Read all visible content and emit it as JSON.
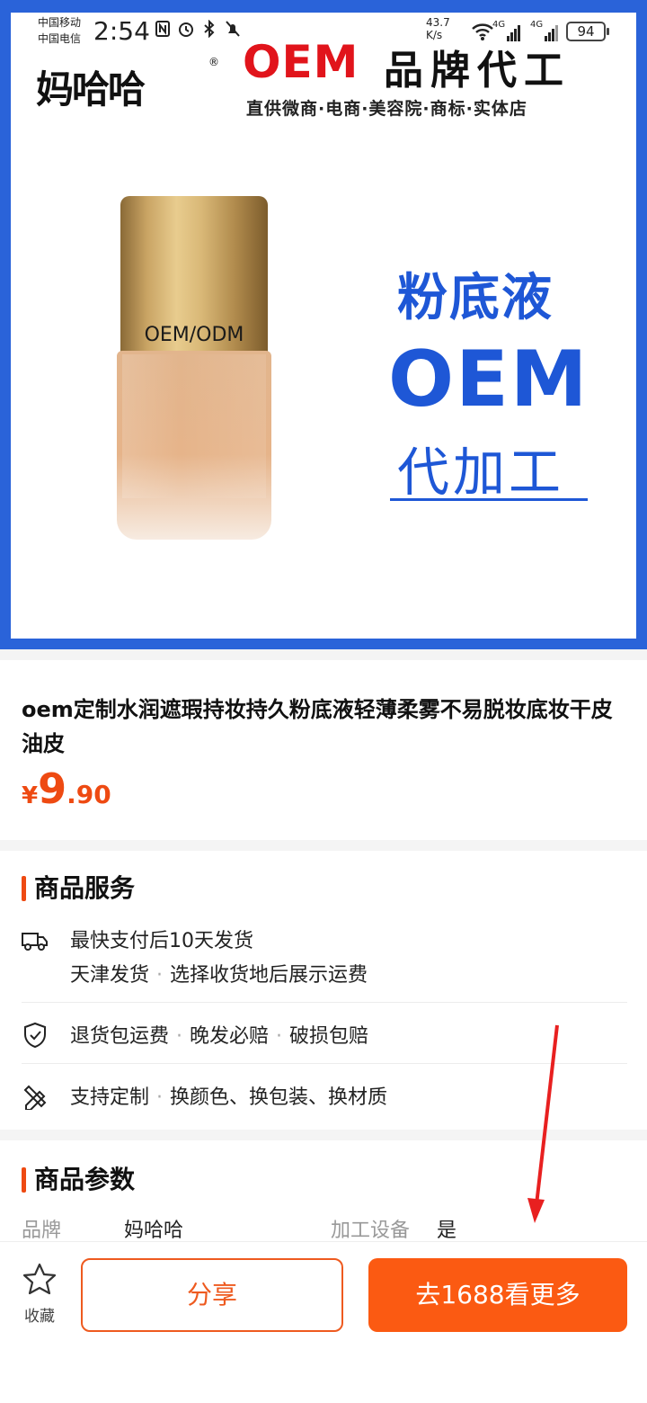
{
  "status_bar": {
    "carrier1": "中国移动",
    "carrier2": "中国电信",
    "time": "2:54",
    "net_speed": "43.7",
    "net_unit": "K/s",
    "sig1": "4G",
    "sig2": "4G",
    "battery": "94"
  },
  "hero": {
    "logo_text": "妈哈哈",
    "logo_reg": "®",
    "banner_oem": "OEM",
    "banner_cn": "品牌代工",
    "banner_sub": "直供微商·电商·美容院·商标·实体店",
    "bottle_label": "OEM/ODM",
    "promo_line1": "粉底液",
    "promo_line2": "OEM",
    "promo_line3": "代加工"
  },
  "product": {
    "title": "oem定制水润遮瑕持妆持久粉底液轻薄柔雾不易脱妆底妆干皮油皮",
    "price_symbol": "¥",
    "price_int": "9",
    "price_dec": ".90"
  },
  "services": {
    "heading": "商品服务",
    "row1_a": "最快支付后10天发货",
    "row1_b1": "天津发货",
    "row1_b2": "选择收货地后展示运费",
    "row2_a": "退货包运费",
    "row2_b": "晚发必赔",
    "row2_c": "破损包赔",
    "row3_a": "支持定制",
    "row3_b": "换颜色、换包装、换材质"
  },
  "params": {
    "heading": "商品参数",
    "k1": "品牌",
    "v1": "妈哈哈",
    "k2": "加工设备",
    "v2": "是"
  },
  "bottom": {
    "fav_label": "收藏",
    "share_label": "分享",
    "more_label": "去1688看更多"
  },
  "colors": {
    "accent": "#fb5a12",
    "hero_border": "#2a63d9",
    "promo_blue": "#1e57d6",
    "banner_red": "#e1141b"
  }
}
